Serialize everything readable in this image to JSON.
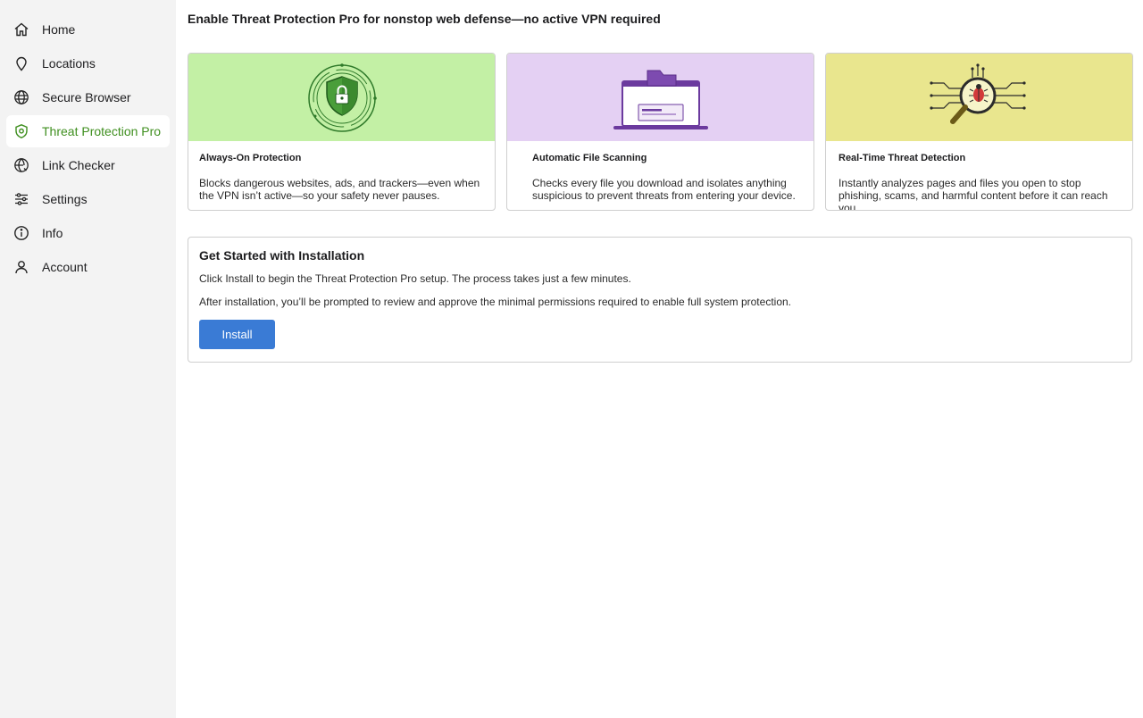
{
  "sidebar": {
    "items": [
      {
        "label": "Home",
        "icon": "home-icon"
      },
      {
        "label": "Locations",
        "icon": "location-pin-icon"
      },
      {
        "label": "Secure Browser",
        "icon": "globe-icon"
      },
      {
        "label": "Threat Protection Pro",
        "icon": "shield-icon",
        "active": true
      },
      {
        "label": "Link Checker",
        "icon": "globe-link-icon"
      },
      {
        "label": "Settings",
        "icon": "sliders-icon"
      },
      {
        "label": "Info",
        "icon": "info-icon"
      },
      {
        "label": "Account",
        "icon": "person-icon"
      }
    ]
  },
  "main": {
    "title": "Enable Threat Protection Pro for nonstop web defense—no active VPN required",
    "cards": [
      {
        "title": "Always-On Protection",
        "description": "Blocks dangerous websites, ads, and trackers—even when the VPN isn’t active—so your safety never pauses.",
        "art": "shield-lock-illustration",
        "bg": "#c3f0a5"
      },
      {
        "title": "Automatic File Scanning",
        "description": "Checks every file you download and isolates anything suspicious to prevent threats from entering your device.",
        "art": "laptop-folder-illustration",
        "bg": "#e4d0f3"
      },
      {
        "title": "Real-Time Threat Detection",
        "description": "Instantly analyzes pages and files you open to stop phishing, scams, and harmful content before it can reach you.",
        "art": "magnifier-bug-illustration",
        "bg": "#e9e68e"
      }
    ],
    "install": {
      "title": "Get Started with Installation",
      "line1": "Click Install to begin the Threat Protection Pro setup. The process takes just a few minutes.",
      "line2": "After installation, you’ll be prompted to review and approve the minimal permissions required to enable full system protection.",
      "button_label": "Install"
    }
  },
  "colors": {
    "accent_green": "#3f8f1f",
    "button_blue": "#3a7bd5",
    "sidebar_bg": "#f3f3f3"
  }
}
